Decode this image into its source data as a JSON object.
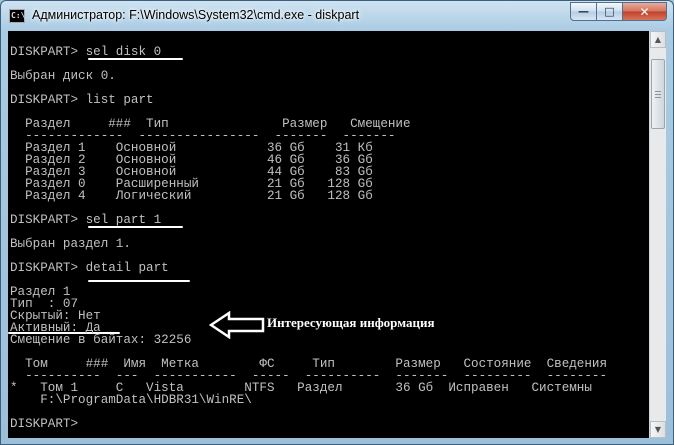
{
  "window": {
    "title": "Администратор: F:\\Windows\\System32\\cmd.exe - diskpart",
    "app_icon_label": "C:\\",
    "controls": {
      "minimize": "—",
      "maximize": "□",
      "close": "✕"
    }
  },
  "console": {
    "lines": [
      "DISKPART> sel disk 0",
      "",
      "Выбран диск 0.",
      "",
      "DISKPART> list part",
      "",
      "  Раздел     ###  Тип               Размер   Смещение",
      "  -------------  ----------------  -------  -------",
      "  Раздел 1    Основной            36 Gб    31 Кб",
      "  Раздел 2    Основной            46 Gб    36 Gб",
      "  Раздел 3    Основной            44 Gб    83 Gб",
      "  Раздел 0    Расширенный         21 Gб   128 Gб",
      "  Раздел 4    Логический          21 Gб   128 Gб",
      "",
      "DISKPART> sel part 1",
      "",
      "Выбран раздел 1.",
      "",
      "DISKPART> detail part",
      "",
      "Раздел 1",
      "Тип  : 07",
      "Скрытый: Нет",
      "Активный: Да",
      "Смещение в байтах: 32256",
      "",
      "  Том     ###  Имя  Метка        ФС     Тип        Размер   Состояние  Сведения",
      "  ----------  ---  -----------  -----  ----------  -------  ---------  --------",
      "*   Том 1     C   Vista        NTFS   Раздел       36 Gб  Исправен   Системны",
      "    F:\\ProgramData\\HDBR31\\WinRE\\",
      "",
      "DISKPART> "
    ]
  },
  "annotation": {
    "label": "Интересующая информация"
  },
  "colors": {
    "console_bg": "#000000",
    "console_text": "#c0c0c0",
    "annotation": "#ffffff"
  }
}
